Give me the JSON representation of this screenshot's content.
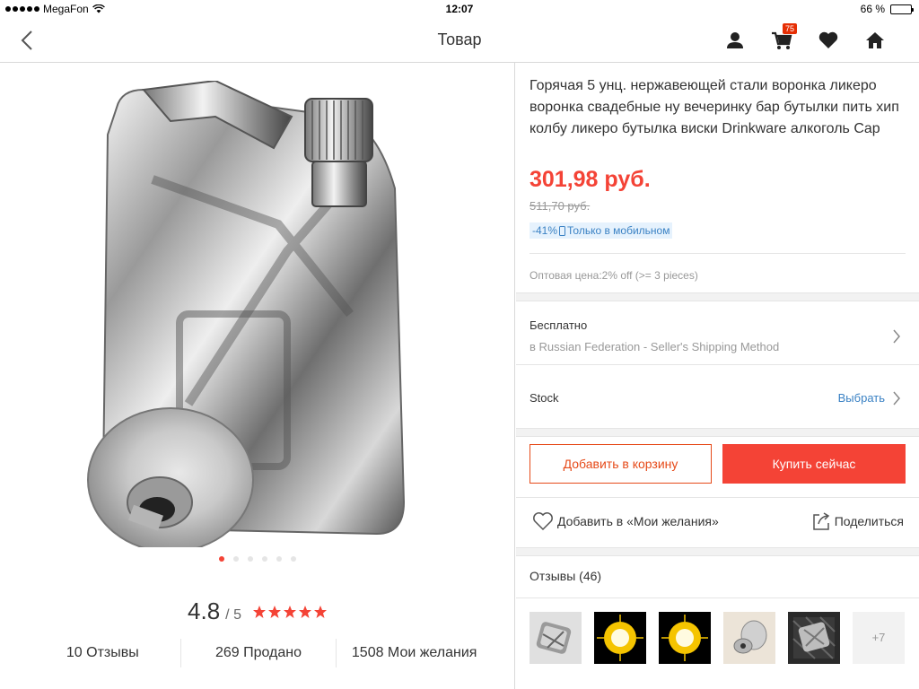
{
  "status": {
    "carrier": "MegaFon",
    "time": "12:07",
    "battery": "66 %",
    "battery_level": 0.66
  },
  "nav": {
    "title": "Товар",
    "cart_count": "75"
  },
  "gallery": {
    "pages": 6,
    "active": 0
  },
  "rating": {
    "value": "4.8",
    "of": "/ 5",
    "stars": 5
  },
  "stats": {
    "reviews": "10 Отзывы",
    "sold": "269 Продано",
    "wishes": "1508 Мои желания"
  },
  "product": {
    "title": "Горячая 5 унц. нержавеющей стали воронка ликеро воронка свадебные ну вечеринку бар бутылки пить хип колбу ликеро бутылка виски Drinkware алкоголь Cap",
    "price": "301,98 руб.",
    "old_price": "511,70 руб.",
    "discount": "-41%",
    "mobile_only": "Только в мобильном",
    "wholesale": "Оптовая цена:2% off (>= 3 pieces)"
  },
  "shipping": {
    "title": "Бесплатно",
    "subtitle": "в Russian Federation - Seller's Shipping Method"
  },
  "stock": {
    "label": "Stock",
    "choose": "Выбрать"
  },
  "buttons": {
    "add_to_cart": "Добавить в корзину",
    "buy_now": "Купить сейчас"
  },
  "actions": {
    "wishlist": "Добавить в «Мои желания»",
    "share": "Поделиться"
  },
  "reviews": {
    "title": "Отзывы (46)",
    "more": "+7"
  },
  "colors": {
    "accent": "#f44336",
    "link": "#3b82c4"
  }
}
